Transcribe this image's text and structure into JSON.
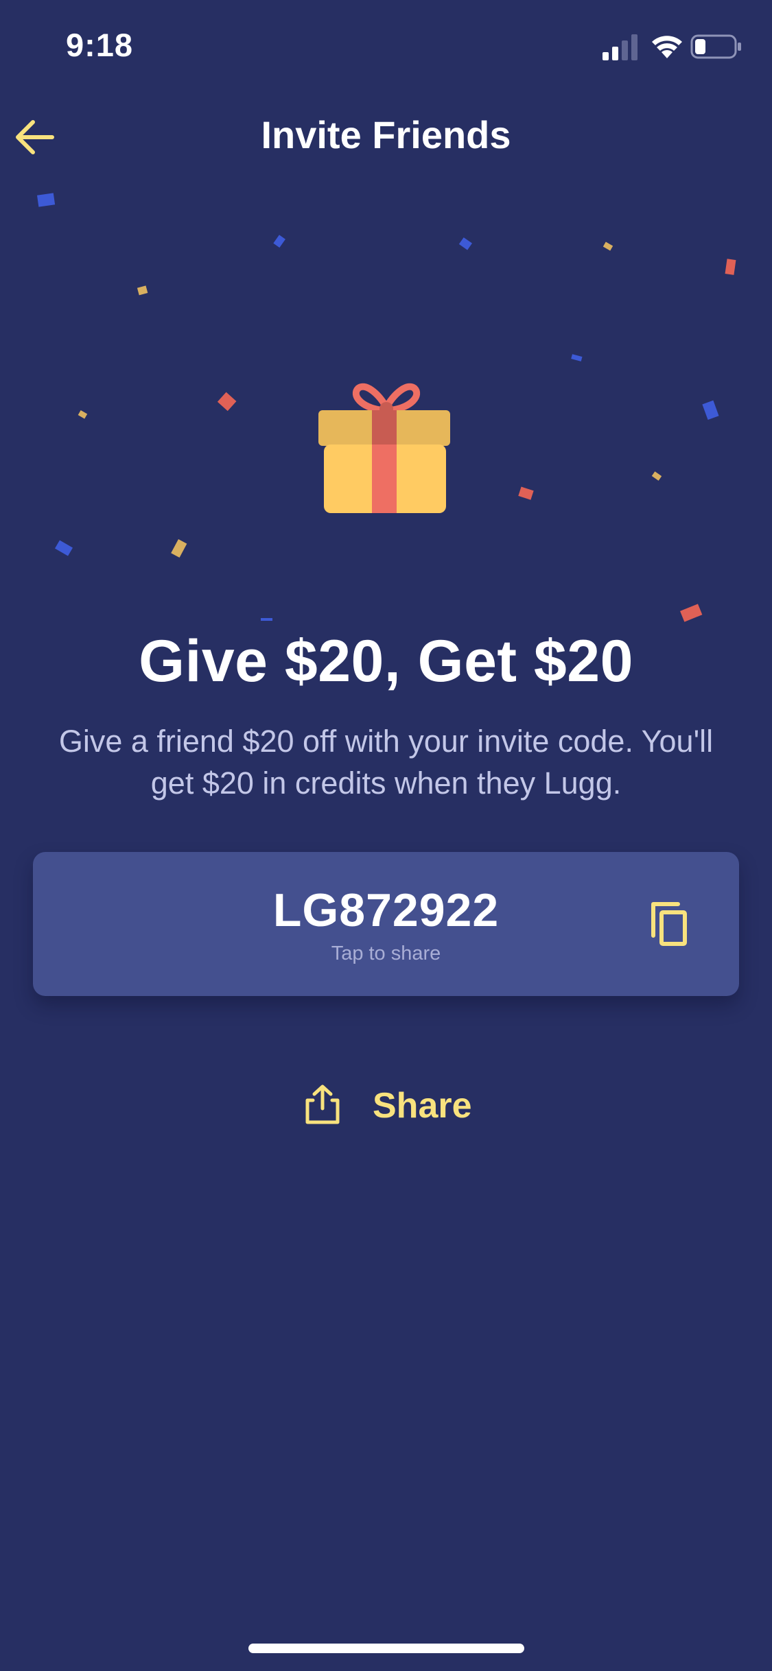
{
  "status_bar": {
    "time": "9:18"
  },
  "nav": {
    "title": "Invite Friends",
    "back_icon": "arrow-left-icon"
  },
  "hero": {
    "icon": "gift-icon",
    "headline": "Give $20, Get $20",
    "subtitle": "Give a friend $20 off with your invite code. You'll get $20 in credits when they Lugg."
  },
  "invite_code": {
    "code": "LG872922",
    "hint": "Tap to share",
    "copy_icon": "copy-icon"
  },
  "share": {
    "label": "Share",
    "icon": "share-icon"
  },
  "colors": {
    "background": "#272f63",
    "card": "#44508f",
    "accent_yellow": "#f8e27e",
    "gift_body": "#ffcb62",
    "gift_ribbon": "#ee6f63",
    "confetti_blue": "#3d5ad6",
    "confetti_red": "#e06156",
    "confetti_gold": "#d9b060"
  }
}
